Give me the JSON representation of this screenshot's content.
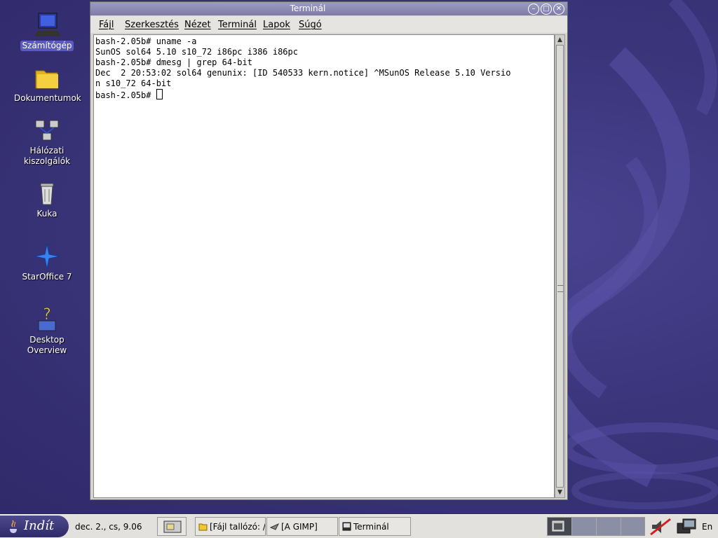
{
  "desktop": {
    "icons": [
      {
        "label": "Számítógép",
        "icon": "computer-icon",
        "selected": true
      },
      {
        "label": "Dokumentumok",
        "icon": "folder-icon"
      },
      {
        "label_lines": [
          "Hálózati",
          "kiszolgálók"
        ],
        "icon": "network-icon"
      },
      {
        "label": "Kuka",
        "icon": "trash-icon"
      },
      {
        "label": "StarOffice 7",
        "icon": "staroffice-icon"
      },
      {
        "label_lines": [
          "Desktop",
          "Overview"
        ],
        "icon": "help-icon"
      }
    ]
  },
  "window": {
    "title": "Terminál",
    "menu": [
      "Fájl",
      "Szerkesztés",
      "Nézet",
      "Terminál",
      "Lapok",
      "Súgó"
    ],
    "terminal_lines": [
      "bash-2.05b# uname -a",
      "SunOS sol64 5.10 s10_72 i86pc i386 i86pc",
      "bash-2.05b# dmesg | grep 64-bit",
      "Dec  2 20:53:02 sol64 genunix: [ID 540533 kern.notice] ^MSunOS Release 5.10 Versio",
      "n s10_72 64-bit"
    ],
    "prompt": "bash-2.05b# "
  },
  "taskbar": {
    "start_label": "Indít",
    "clock": "dec. 2., cs,  9.06",
    "tasks": [
      {
        "label": "[Fájl tallózó: /",
        "icon": "folder-icon"
      },
      {
        "label": "[A GIMP]",
        "icon": "gimp-icon"
      },
      {
        "label": "Terminál",
        "icon": "terminal-icon"
      }
    ],
    "language": "En"
  },
  "colors": {
    "desktop_bg": "#3b357c",
    "titlebar": "#8a8ab4",
    "selection": "#5a5ac0"
  }
}
